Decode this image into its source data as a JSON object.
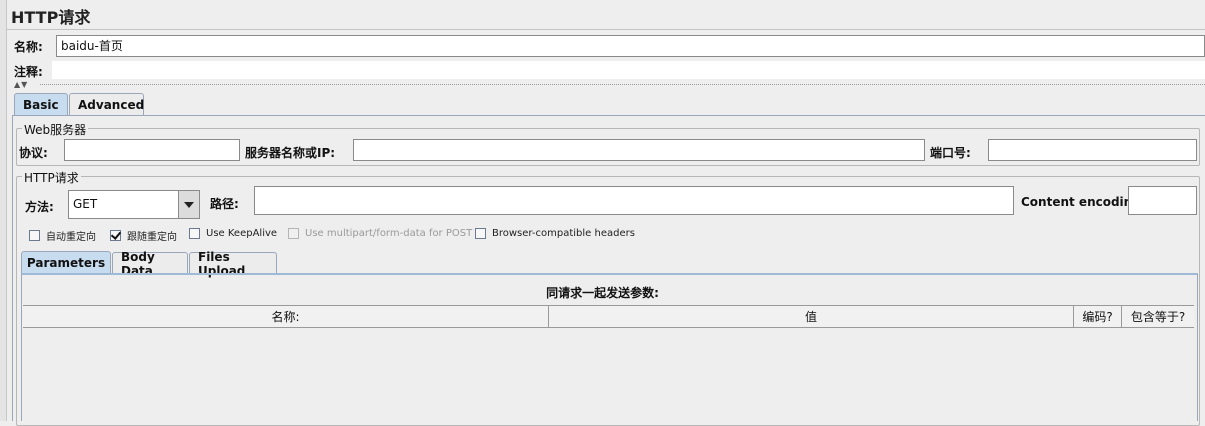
{
  "page": {
    "title": "HTTP请求",
    "name_label": "名称:",
    "name_value": "baidu-首页",
    "comment_label": "注释:",
    "comment_value": ""
  },
  "tabs": {
    "top": [
      "Basic",
      "Advanced"
    ],
    "active": "Basic"
  },
  "web_server": {
    "group_title": "Web服务器",
    "protocol_label": "协议:",
    "protocol_value": "",
    "server_label": "服务器名称或IP:",
    "server_value": "",
    "port_label": "端口号:",
    "port_value": ""
  },
  "http_request": {
    "group_title": "HTTP请求",
    "method_label": "方法:",
    "method_value": "GET",
    "path_label": "路径:",
    "path_value": "",
    "encoding_label": "Content encoding:",
    "encoding_value": ""
  },
  "checkboxes": [
    {
      "label": "自动重定向",
      "checked": false,
      "enabled": true
    },
    {
      "label": "跟随重定向",
      "checked": true,
      "enabled": true
    },
    {
      "label": "Use KeepAlive",
      "checked": false,
      "enabled": true
    },
    {
      "label": "Use multipart/form-data for POST",
      "checked": false,
      "enabled": false
    },
    {
      "label": "Browser-compatible headers",
      "checked": false,
      "enabled": true
    }
  ],
  "sub_tabs": {
    "items": [
      "Parameters",
      "Body Data",
      "Files Upload"
    ],
    "active": "Parameters"
  },
  "params_table": {
    "caption": "同请求一起发送参数:",
    "columns": [
      "名称:",
      "值",
      "编码?",
      "包含等于?"
    ],
    "rows": []
  },
  "colors": {
    "active_tab": "#c8dcf0",
    "panel_border": "#9aa7b8",
    "background": "#eeeeee"
  },
  "icons": [
    "chevron-down-icon",
    "collapse-grip-icon"
  ]
}
